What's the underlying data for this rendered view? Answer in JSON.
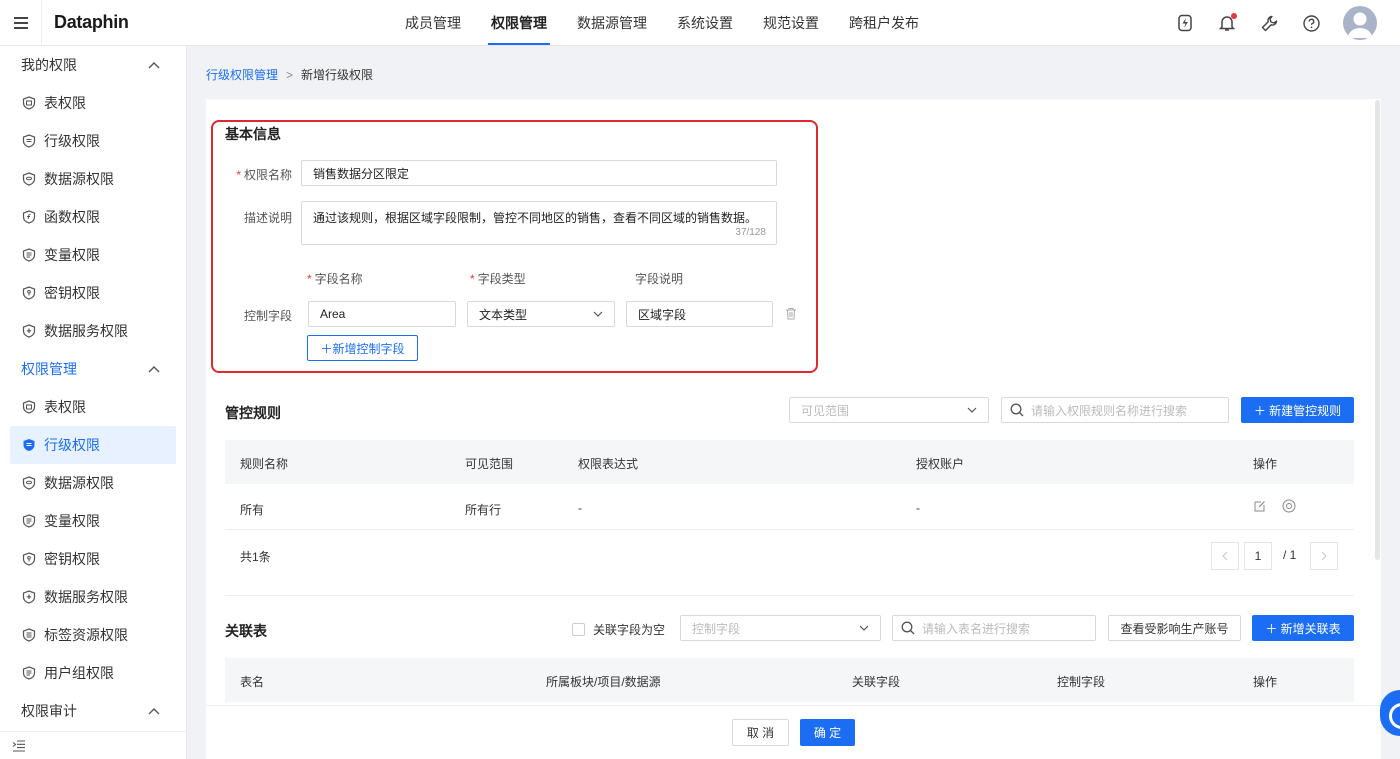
{
  "app": {
    "logo": "Dataphin"
  },
  "topnav": [
    {
      "label": "成员管理"
    },
    {
      "label": "权限管理",
      "active": true
    },
    {
      "label": "数据源管理"
    },
    {
      "label": "系统设置"
    },
    {
      "label": "规范设置"
    },
    {
      "label": "跨租户发布"
    }
  ],
  "sidebar": {
    "group1": "我的权限",
    "group1_items": [
      "表权限",
      "行级权限",
      "数据源权限",
      "函数权限",
      "变量权限",
      "密钥权限",
      "数据服务权限"
    ],
    "group2": "权限管理",
    "group2_items": [
      "表权限",
      "行级权限",
      "数据源权限",
      "变量权限",
      "密钥权限",
      "数据服务权限",
      "标签资源权限",
      "用户组权限"
    ],
    "group3": "权限审计"
  },
  "breadcrumb": {
    "parent": "行级权限管理",
    "sep": ">",
    "current": "新增行级权限"
  },
  "basic": {
    "title": "基本信息",
    "name_label": "权限名称",
    "name_value": "销售数据分区限定",
    "desc_label": "描述说明",
    "desc_value": "通过该规则，根据区域字段限制，管控不同地区的销售，查看不同区域的销售数据。",
    "desc_counter": "37/128",
    "col_field_name": "字段名称",
    "col_field_type": "字段类型",
    "col_field_desc": "字段说明",
    "control_label": "控制字段",
    "field_name_value": "Area",
    "field_type_value": "文本类型",
    "field_desc_value": "区域字段",
    "add_field_btn": "＋新增控制字段"
  },
  "rules": {
    "title": "管控规则",
    "scope_placeholder": "可见范围",
    "search_placeholder": "请输入权限规则名称进行搜索",
    "new_btn": "＋ 新建管控规则",
    "columns": [
      "规则名称",
      "可见范围",
      "权限表达式",
      "授权账户",
      "操作"
    ],
    "rows": [
      {
        "name": "所有",
        "scope": "所有行",
        "expr": "-",
        "account": "-"
      }
    ],
    "total": "共1条",
    "page": "1",
    "page_total": "/ 1"
  },
  "related": {
    "title": "关联表",
    "checkbox_label": "关联字段为空",
    "control_placeholder": "控制字段",
    "search_placeholder": "请输入表名进行搜索",
    "view_btn": "查看受影响生产账号",
    "new_btn": "＋ 新增关联表",
    "columns": [
      "表名",
      "所属板块/项目/数据源",
      "关联字段",
      "控制字段",
      "操作"
    ]
  },
  "footer": {
    "cancel": "取 消",
    "confirm": "确 定"
  },
  "colors": {
    "accent": "#1b6ef3",
    "highlight_border": "#e0292e"
  }
}
